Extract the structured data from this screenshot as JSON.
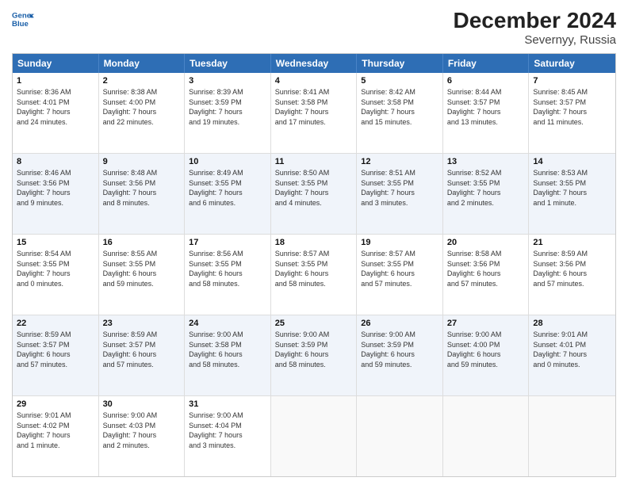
{
  "header": {
    "logo_line1": "General",
    "logo_line2": "Blue",
    "title": "December 2024",
    "subtitle": "Severnyy, Russia"
  },
  "days_of_week": [
    "Sunday",
    "Monday",
    "Tuesday",
    "Wednesday",
    "Thursday",
    "Friday",
    "Saturday"
  ],
  "rows": [
    [
      {
        "day": "1",
        "info": "Sunrise: 8:36 AM\nSunset: 4:01 PM\nDaylight: 7 hours\nand 24 minutes."
      },
      {
        "day": "2",
        "info": "Sunrise: 8:38 AM\nSunset: 4:00 PM\nDaylight: 7 hours\nand 22 minutes."
      },
      {
        "day": "3",
        "info": "Sunrise: 8:39 AM\nSunset: 3:59 PM\nDaylight: 7 hours\nand 19 minutes."
      },
      {
        "day": "4",
        "info": "Sunrise: 8:41 AM\nSunset: 3:58 PM\nDaylight: 7 hours\nand 17 minutes."
      },
      {
        "day": "5",
        "info": "Sunrise: 8:42 AM\nSunset: 3:58 PM\nDaylight: 7 hours\nand 15 minutes."
      },
      {
        "day": "6",
        "info": "Sunrise: 8:44 AM\nSunset: 3:57 PM\nDaylight: 7 hours\nand 13 minutes."
      },
      {
        "day": "7",
        "info": "Sunrise: 8:45 AM\nSunset: 3:57 PM\nDaylight: 7 hours\nand 11 minutes."
      }
    ],
    [
      {
        "day": "8",
        "info": "Sunrise: 8:46 AM\nSunset: 3:56 PM\nDaylight: 7 hours\nand 9 minutes."
      },
      {
        "day": "9",
        "info": "Sunrise: 8:48 AM\nSunset: 3:56 PM\nDaylight: 7 hours\nand 8 minutes."
      },
      {
        "day": "10",
        "info": "Sunrise: 8:49 AM\nSunset: 3:55 PM\nDaylight: 7 hours\nand 6 minutes."
      },
      {
        "day": "11",
        "info": "Sunrise: 8:50 AM\nSunset: 3:55 PM\nDaylight: 7 hours\nand 4 minutes."
      },
      {
        "day": "12",
        "info": "Sunrise: 8:51 AM\nSunset: 3:55 PM\nDaylight: 7 hours\nand 3 minutes."
      },
      {
        "day": "13",
        "info": "Sunrise: 8:52 AM\nSunset: 3:55 PM\nDaylight: 7 hours\nand 2 minutes."
      },
      {
        "day": "14",
        "info": "Sunrise: 8:53 AM\nSunset: 3:55 PM\nDaylight: 7 hours\nand 1 minute."
      }
    ],
    [
      {
        "day": "15",
        "info": "Sunrise: 8:54 AM\nSunset: 3:55 PM\nDaylight: 7 hours\nand 0 minutes."
      },
      {
        "day": "16",
        "info": "Sunrise: 8:55 AM\nSunset: 3:55 PM\nDaylight: 6 hours\nand 59 minutes."
      },
      {
        "day": "17",
        "info": "Sunrise: 8:56 AM\nSunset: 3:55 PM\nDaylight: 6 hours\nand 58 minutes."
      },
      {
        "day": "18",
        "info": "Sunrise: 8:57 AM\nSunset: 3:55 PM\nDaylight: 6 hours\nand 58 minutes."
      },
      {
        "day": "19",
        "info": "Sunrise: 8:57 AM\nSunset: 3:55 PM\nDaylight: 6 hours\nand 57 minutes."
      },
      {
        "day": "20",
        "info": "Sunrise: 8:58 AM\nSunset: 3:56 PM\nDaylight: 6 hours\nand 57 minutes."
      },
      {
        "day": "21",
        "info": "Sunrise: 8:59 AM\nSunset: 3:56 PM\nDaylight: 6 hours\nand 57 minutes."
      }
    ],
    [
      {
        "day": "22",
        "info": "Sunrise: 8:59 AM\nSunset: 3:57 PM\nDaylight: 6 hours\nand 57 minutes."
      },
      {
        "day": "23",
        "info": "Sunrise: 8:59 AM\nSunset: 3:57 PM\nDaylight: 6 hours\nand 57 minutes."
      },
      {
        "day": "24",
        "info": "Sunrise: 9:00 AM\nSunset: 3:58 PM\nDaylight: 6 hours\nand 58 minutes."
      },
      {
        "day": "25",
        "info": "Sunrise: 9:00 AM\nSunset: 3:59 PM\nDaylight: 6 hours\nand 58 minutes."
      },
      {
        "day": "26",
        "info": "Sunrise: 9:00 AM\nSunset: 3:59 PM\nDaylight: 6 hours\nand 59 minutes."
      },
      {
        "day": "27",
        "info": "Sunrise: 9:00 AM\nSunset: 4:00 PM\nDaylight: 6 hours\nand 59 minutes."
      },
      {
        "day": "28",
        "info": "Sunrise: 9:01 AM\nSunset: 4:01 PM\nDaylight: 7 hours\nand 0 minutes."
      }
    ],
    [
      {
        "day": "29",
        "info": "Sunrise: 9:01 AM\nSunset: 4:02 PM\nDaylight: 7 hours\nand 1 minute."
      },
      {
        "day": "30",
        "info": "Sunrise: 9:00 AM\nSunset: 4:03 PM\nDaylight: 7 hours\nand 2 minutes."
      },
      {
        "day": "31",
        "info": "Sunrise: 9:00 AM\nSunset: 4:04 PM\nDaylight: 7 hours\nand 3 minutes."
      },
      {
        "day": "",
        "info": ""
      },
      {
        "day": "",
        "info": ""
      },
      {
        "day": "",
        "info": ""
      },
      {
        "day": "",
        "info": ""
      }
    ]
  ]
}
